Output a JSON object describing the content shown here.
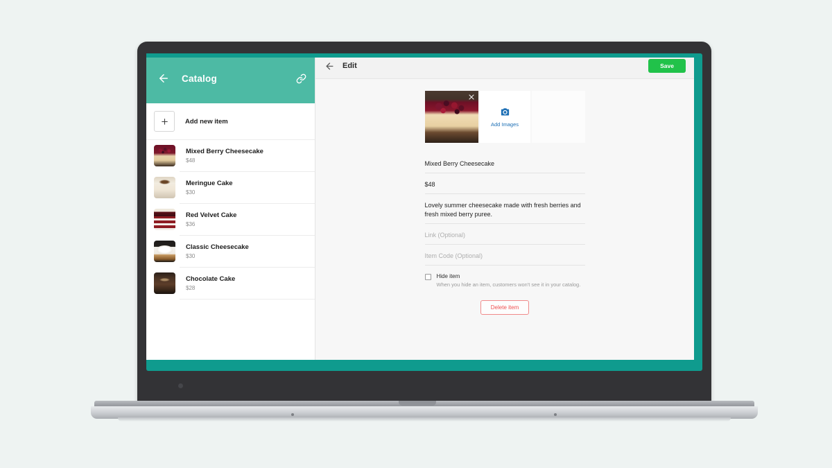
{
  "catalog": {
    "title": "Catalog",
    "back_icon": "arrow-left-icon",
    "link_icon": "link-icon",
    "add_new_label": "Add new item",
    "items": [
      {
        "name": "Mixed Berry Cheesecake",
        "price": "$48",
        "thumb": "berry-cheesecake-thumbnail"
      },
      {
        "name": "Meringue Cake",
        "price": "$30",
        "thumb": "meringue-cake-thumbnail"
      },
      {
        "name": "Red Velvet Cake",
        "price": "$36",
        "thumb": "red-velvet-cake-thumbnail"
      },
      {
        "name": "Classic Cheesecake",
        "price": "$30",
        "thumb": "classic-cheesecake-thumbnail"
      },
      {
        "name": "Chocolate Cake",
        "price": "$28",
        "thumb": "chocolate-cake-thumbnail"
      }
    ]
  },
  "editor": {
    "title": "Edit",
    "back_icon": "arrow-left-icon",
    "save_label": "Save",
    "images": {
      "photo_alt": "mixed-berry-cheesecake-photo",
      "remove_icon": "close-icon",
      "camera_icon": "camera-icon",
      "add_images_label": "Add Images"
    },
    "fields": {
      "name_value": "Mixed Berry Cheesecake",
      "price_value": "$48",
      "description_value": "Lovely summer cheesecake made with fresh berries and fresh mixed berry puree.",
      "link_placeholder": "Link (Optional)",
      "item_code_placeholder": "Item Code (Optional)"
    },
    "hide_item": {
      "label": "Hide item",
      "description": "When you hide an item, customers won't see it in your catalog.",
      "checked": false
    },
    "delete_label": "Delete item"
  },
  "colors": {
    "catalog_header_teal": "#4dbaa4",
    "screen_strip_teal": "#0f9b8e",
    "save_green": "#21c24a",
    "add_images_blue": "#1d6fb5",
    "delete_red": "#f05050",
    "page_background": "#eef3f2"
  }
}
